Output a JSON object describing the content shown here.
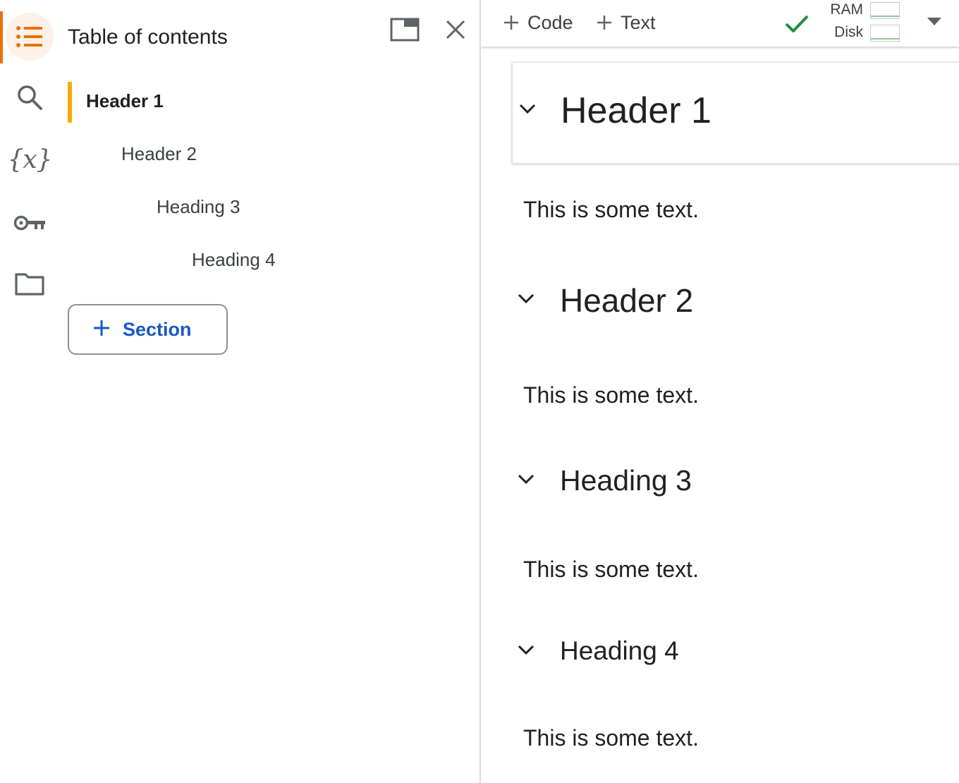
{
  "sidebar": {
    "rail": [
      {
        "icon": "toc-list-icon",
        "active": true
      },
      {
        "icon": "search-icon"
      },
      {
        "icon": "variables-icon",
        "glyph": "{x}"
      },
      {
        "icon": "key-icon"
      },
      {
        "icon": "folder-icon"
      }
    ],
    "accent_color": "#e8710a"
  },
  "toc": {
    "title": "Table of contents",
    "items": [
      {
        "label": "Header 1",
        "level": 1,
        "active": true
      },
      {
        "label": "Header 2",
        "level": 2
      },
      {
        "label": "Heading 3",
        "level": 3
      },
      {
        "label": "Heading 4",
        "level": 4
      }
    ],
    "section_button": {
      "label": "Section",
      "icon": "plus-icon"
    },
    "active_bar_color": "#f9ab00",
    "link_color": "#1a56c8"
  },
  "toolbar": {
    "add_code_label": "Code",
    "add_text_label": "Text",
    "status_icon": "check-icon",
    "ram_label": "RAM",
    "disk_label": "Disk",
    "connected_color": "#1e8e3e"
  },
  "notebook": {
    "cells": [
      {
        "heading": "Header 1",
        "level": 1,
        "text": "This is some text.",
        "selected": true
      },
      {
        "heading": "Header 2",
        "level": 2,
        "text": "This is some text."
      },
      {
        "heading": "Heading 3",
        "level": 3,
        "text": "This is some text."
      },
      {
        "heading": "Heading 4",
        "level": 4,
        "text": "This is some text."
      }
    ]
  }
}
